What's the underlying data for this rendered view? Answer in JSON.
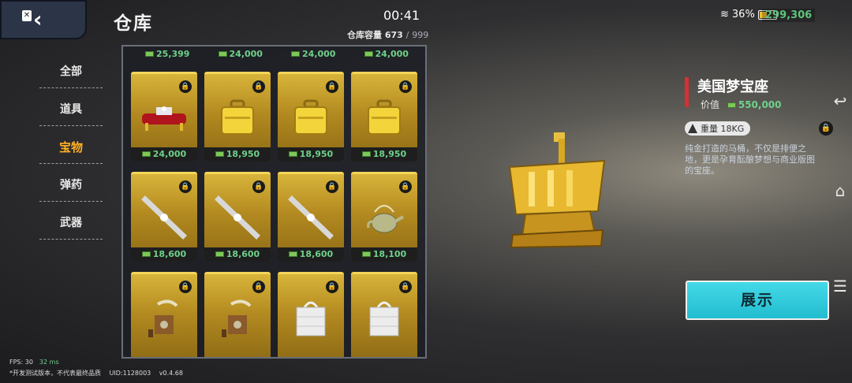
{
  "header": {
    "title": "仓库",
    "clock": "00:41",
    "capacity_label": "仓库容量",
    "capacity_used": "673",
    "capacity_max": "999",
    "battery": "36%",
    "money": "299,306"
  },
  "sidebar": {
    "items": [
      {
        "label": "全部",
        "active": false
      },
      {
        "label": "道具",
        "active": false
      },
      {
        "label": "宝物",
        "active": true
      },
      {
        "label": "弹药",
        "active": false
      },
      {
        "label": "武器",
        "active": false
      }
    ]
  },
  "grid": {
    "top_prices": [
      "25,399",
      "24,000",
      "24,000",
      "24,000"
    ],
    "items": [
      {
        "icon": "pillow-crown-icon",
        "price": "24,000"
      },
      {
        "icon": "gold-suitcase-icon",
        "price": "18,950"
      },
      {
        "icon": "gold-suitcase-icon",
        "price": "18,950"
      },
      {
        "icon": "gold-suitcase-icon",
        "price": "18,950"
      },
      {
        "icon": "silver-bar-icon",
        "price": "18,600"
      },
      {
        "icon": "silver-bar-icon",
        "price": "18,600"
      },
      {
        "icon": "silver-bar-icon",
        "price": "18,600"
      },
      {
        "icon": "jade-teapot-icon",
        "price": "18,100"
      },
      {
        "icon": "gramophone-icon",
        "price": ""
      },
      {
        "icon": "gramophone-icon",
        "price": ""
      },
      {
        "icon": "white-bag-icon",
        "price": ""
      },
      {
        "icon": "white-bag-icon",
        "price": ""
      }
    ]
  },
  "detail": {
    "name": "美国梦宝座",
    "value_label": "价值",
    "value": "550,000",
    "weight": "重量 18KG",
    "description": "纯金打造的马桶，不仅是排便之地，更是孕育酝酿梦想与商业版图的宝座。",
    "showcase_label": "展示",
    "accent_color": "#d83030",
    "button_color": "#33cadc"
  },
  "footer": {
    "fps": "FPS: 30",
    "ping": "32 ms",
    "notice": "*开发测试版本，不代表最终品质",
    "uid": "UID:1128003",
    "version": "v0.4.68"
  }
}
